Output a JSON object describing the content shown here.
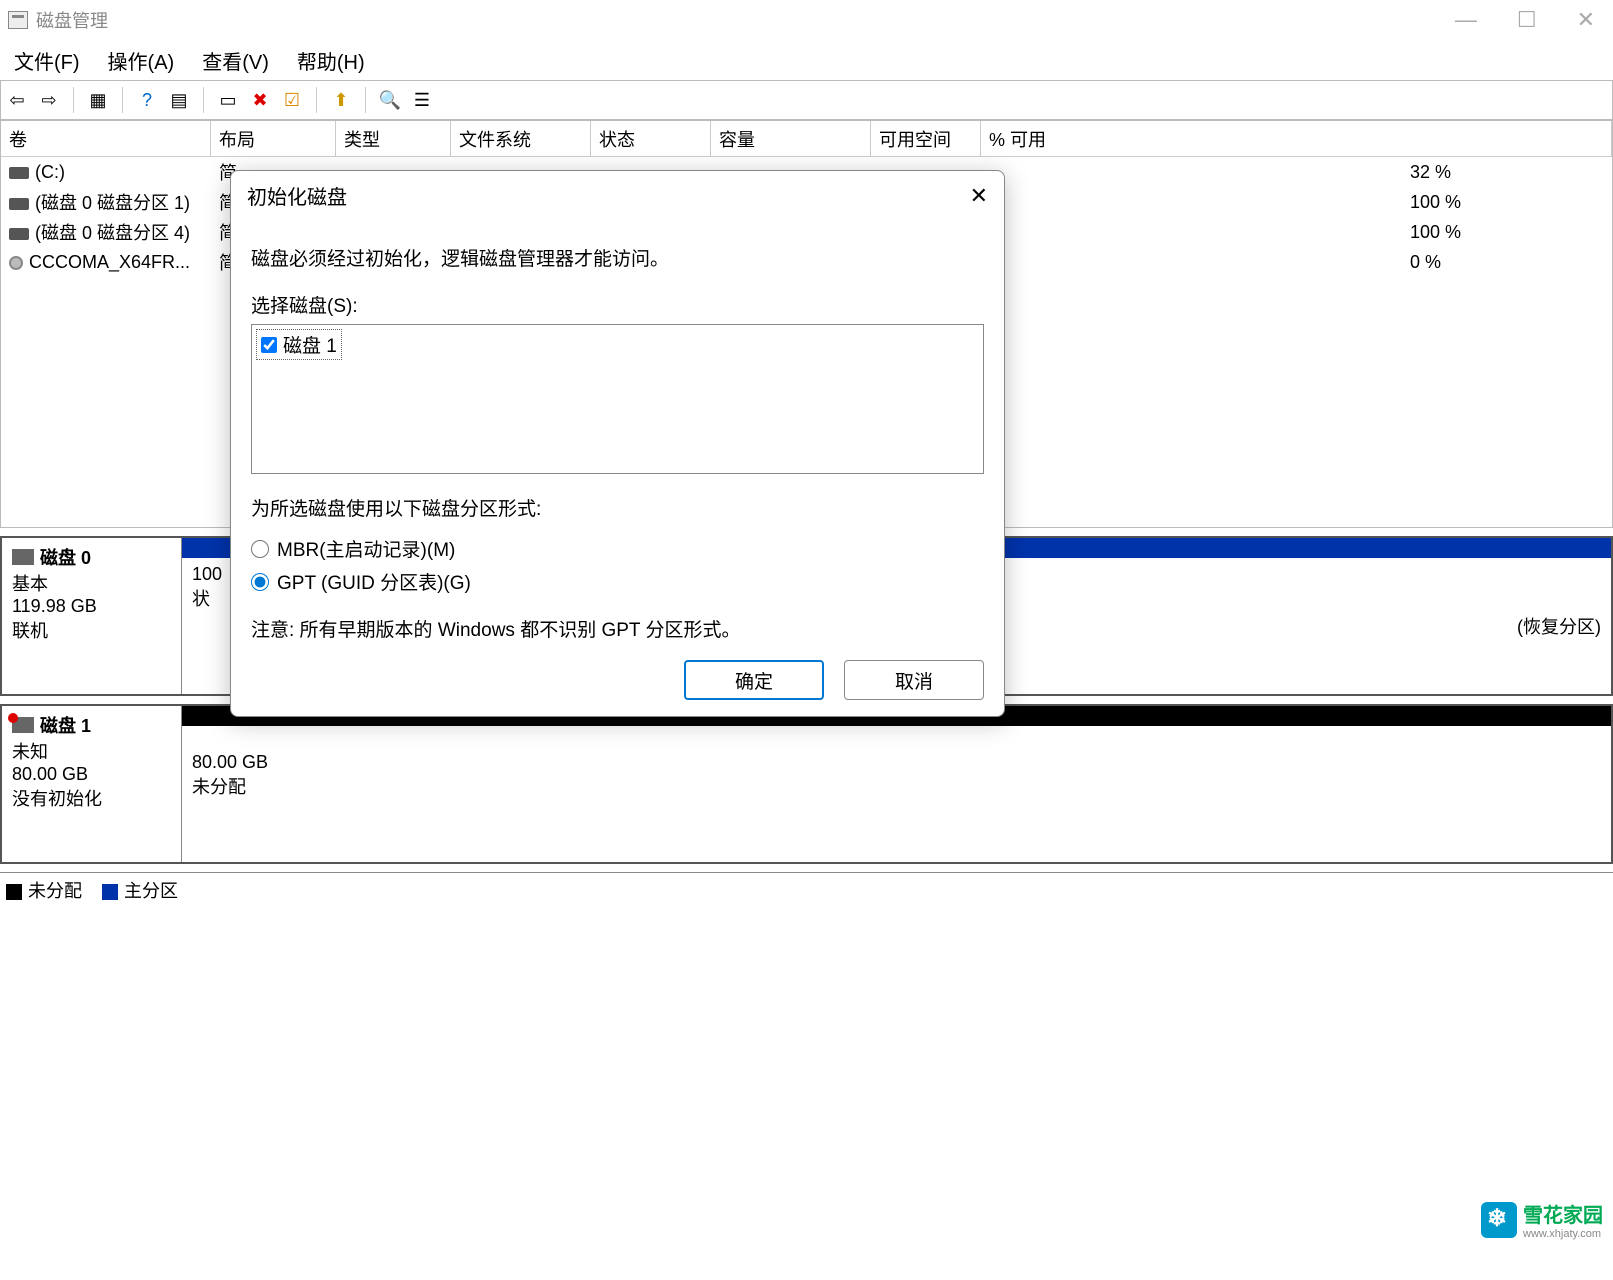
{
  "window": {
    "title": "磁盘管理",
    "controls": {
      "min": "—",
      "max": "☐",
      "close": "✕"
    }
  },
  "menu": {
    "file": "文件(F)",
    "action": "操作(A)",
    "view": "查看(V)",
    "help": "帮助(H)"
  },
  "columns": {
    "vol": "卷",
    "layout": "布局",
    "type": "类型",
    "fs": "文件系统",
    "status": "状态",
    "cap": "容量",
    "free": "可用空间",
    "pct": "% 可用"
  },
  "rows": [
    {
      "name": "(C:)",
      "layout": "简",
      "pct": "32 %"
    },
    {
      "name": "(磁盘 0 磁盘分区 1)",
      "layout": "简",
      "pct": "100 %"
    },
    {
      "name": "(磁盘 0 磁盘分区 4)",
      "layout": "简",
      "pct": "100 %"
    },
    {
      "name": "CCCOMA_X64FR...",
      "layout": "简",
      "pct": "0 %"
    }
  ],
  "disk0": {
    "title": "磁盘 0",
    "type": "基本",
    "size": "119.98 GB",
    "status": "联机",
    "part_size": "100",
    "part_status": "状",
    "recovery": "(恢复分区)"
  },
  "disk1": {
    "title": "磁盘 1",
    "type": "未知",
    "size": "80.00 GB",
    "status": "没有初始化",
    "body_size": "80.00 GB",
    "body_status": "未分配"
  },
  "legend": {
    "unalloc": "未分配",
    "primary": "主分区"
  },
  "modal": {
    "title": "初始化磁盘",
    "msg1": "磁盘必须经过初始化，逻辑磁盘管理器才能访问。",
    "select_label": "选择磁盘(S):",
    "disk_item": "磁盘 1",
    "partition_label": "为所选磁盘使用以下磁盘分区形式:",
    "mbr": "MBR(主启动记录)(M)",
    "gpt": "GPT (GUID 分区表)(G)",
    "note": "注意: 所有早期版本的 Windows 都不识别 GPT 分区形式。",
    "ok": "确定",
    "cancel": "取消"
  },
  "watermark": {
    "name": "雪花家园",
    "url": "www.xhjaty.com"
  }
}
